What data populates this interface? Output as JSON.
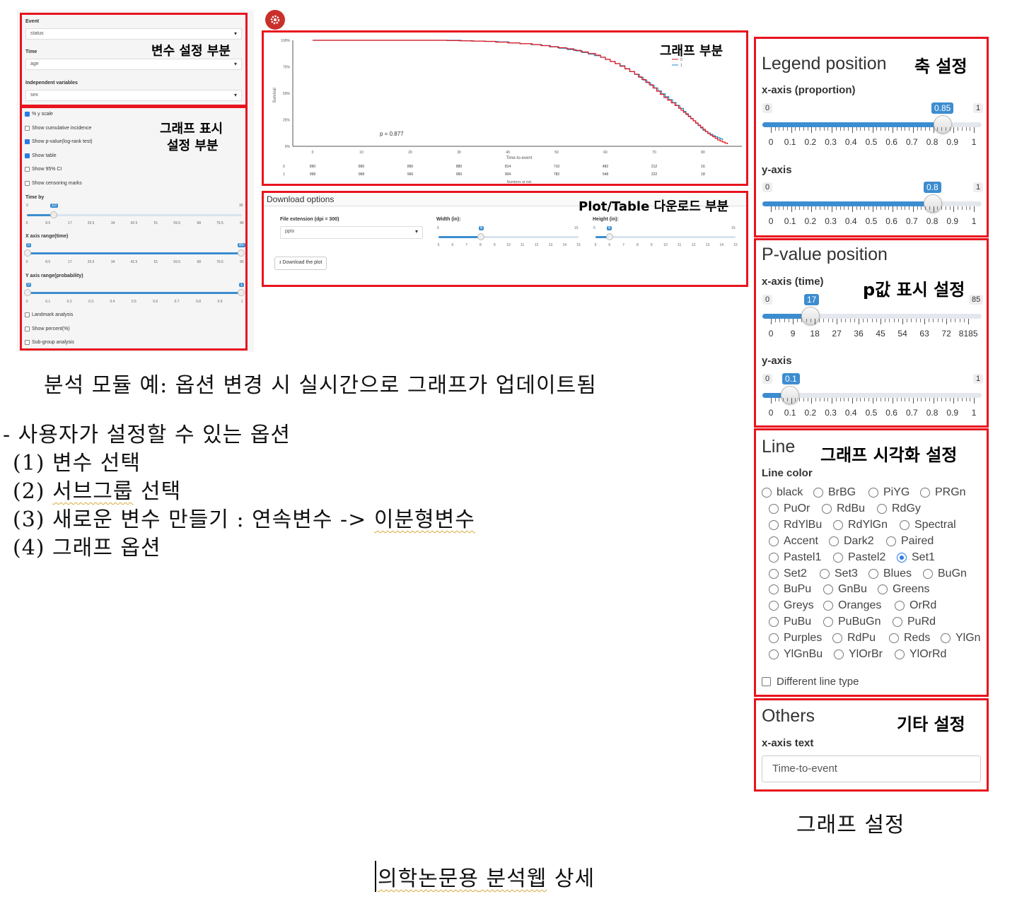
{
  "left_panel": {
    "event_label": "Event",
    "event_value": "status",
    "time_label": "Time",
    "time_value": "age",
    "indep_label": "Independent variables",
    "indep_value": "sex",
    "annot_variables": "변수 설정 부분",
    "annot_display_1": "그래프 표시",
    "annot_display_2": "설정 부분",
    "checks": [
      {
        "label": "% y scale",
        "checked": true
      },
      {
        "label": "Show cumulative incidence",
        "checked": false
      },
      {
        "label": "Show p-value(log-rank test)",
        "checked": true
      },
      {
        "label": "Show table",
        "checked": true
      },
      {
        "label": "Show 95% CI",
        "checked": false
      },
      {
        "label": "Show censoring marks",
        "checked": false
      }
    ],
    "timeby_label": "Time by",
    "timeby_min": "0",
    "timeby_max": "30",
    "timeby_value": "10",
    "timeby_ticks": [
      "0",
      "8.5",
      "17",
      "25.5",
      "34",
      "42.5",
      "51",
      "59.5",
      "68",
      "76.5",
      "85"
    ],
    "xrange_label": "X axis range(time)",
    "xrange_min": "0",
    "xrange_max": "85",
    "xrange_ticks": [
      "0",
      "8.5",
      "17",
      "25.5",
      "34",
      "42.5",
      "51",
      "59.5",
      "68",
      "76.5",
      "85"
    ],
    "yrange_label": "Y axis range(probability)",
    "yrange_min": "0",
    "yrange_max": "1",
    "yrange_ticks": [
      "0",
      "0.1",
      "0.2",
      "0.3",
      "0.4",
      "0.5",
      "0.6",
      "0.7",
      "0.8",
      "0.9",
      "1"
    ],
    "bottom_checks": [
      "Landmark analysis",
      "Show percent(%)",
      "Sub-group analysis"
    ]
  },
  "plot_panel": {
    "annot": "그래프 부분",
    "ylabel": "Survival",
    "yticks": [
      "100%",
      "75%",
      "50%",
      "25%",
      "0%"
    ],
    "xticks": [
      "0",
      "10",
      "20",
      "30",
      "40",
      "50",
      "60",
      "70",
      "80"
    ],
    "xlabel": "Time-to-event",
    "pvalue_text": "p = 0.877",
    "legend": [
      "0",
      "1"
    ],
    "risk_row0_label": "0",
    "risk_row0": [
      "890",
      "890",
      "890",
      "880",
      "814",
      "710",
      "482",
      "212",
      "16"
    ],
    "risk_row1_label": "1",
    "risk_row1": [
      "968",
      "968",
      "966",
      "960",
      "904",
      "782",
      "548",
      "222",
      "18"
    ],
    "risk_xlabel": "Numbers at risk"
  },
  "colors": {
    "series0": "#e8141e",
    "series1": "#1f8fc4",
    "accent": "#3c8dd0",
    "frame": "#e8141e"
  },
  "download_panel": {
    "title": "Download options",
    "annot": "Plot/Table 다운로드 부분",
    "ext_label": "File extension (dpi = 300)",
    "ext_value": "pptx",
    "width_label": "Width (in):",
    "width_value": "6",
    "width_min": "5",
    "width_max": "15",
    "height_label": "Height (in):",
    "height_value": "6",
    "height_min": "5",
    "height_max": "15",
    "size_ticks": [
      "5",
      "6",
      "7",
      "8",
      "9",
      "10",
      "11",
      "12",
      "13",
      "14",
      "15"
    ],
    "button": "Download the plot"
  },
  "captions": {
    "module": "분석 모듈 예: 옵션 변경 시 실시간으로 그래프가 업데이트됨",
    "options_title": "- 사용자가 설정할 수 있는 옵션",
    "opt1": "(1) 변수 선택",
    "opt2a": "(2) ",
    "opt2b": "서브그룹",
    "opt2c": " 선택",
    "opt3a": "(3) 새로운 변수 만들기 : 연속변수 -> ",
    "opt3b": "이분형변수",
    "opt4": "(4) 그래프 옵션",
    "graph_settings": "그래프 설정",
    "footer_a": "의학논문용",
    "footer_b": " 분석웹",
    "footer_c": " 상세"
  },
  "legend_section": {
    "title": "Legend position",
    "annot": "축 설정",
    "x_label": "x-axis (proportion)",
    "x_min": "0",
    "x_max": "1",
    "x_value": "0.85",
    "y_label": "y-axis",
    "y_min": "0",
    "y_max": "1",
    "y_value": "0.8",
    "ticks": [
      "0",
      "0.1",
      "0.2",
      "0.3",
      "0.4",
      "0.5",
      "0.6",
      "0.7",
      "0.8",
      "0.9",
      "1"
    ]
  },
  "pvalue_section": {
    "title": "P-value position",
    "annot": "p값 표시 설정",
    "x_label": "x-axis (time)",
    "x_min": "0",
    "x_max": "85",
    "x_value": "17",
    "x_ticks": [
      "0",
      "9",
      "18",
      "27",
      "36",
      "45",
      "54",
      "63",
      "72",
      "8185"
    ],
    "y_label": "y-axis",
    "y_min": "0",
    "y_max": "1",
    "y_value": "0.1",
    "y_ticks": [
      "0",
      "0.1",
      "0.2",
      "0.3",
      "0.4",
      "0.5",
      "0.6",
      "0.7",
      "0.8",
      "0.9",
      "1"
    ]
  },
  "line_section": {
    "title": "Line",
    "annot": "그래프 시각화 설정",
    "color_label": "Line color",
    "rows": [
      [
        "black",
        "BrBG",
        "PiYG",
        "PRGn"
      ],
      [
        "PuOr",
        "RdBu",
        "RdGy"
      ],
      [
        "RdYlBu",
        "RdYlGn",
        "Spectral"
      ],
      [
        "Accent",
        "Dark2",
        "Paired"
      ],
      [
        "Pastel1",
        "Pastel2",
        "Set1"
      ],
      [
        "Set2",
        "Set3",
        "Blues",
        "BuGn"
      ],
      [
        "BuPu",
        "GnBu",
        "Greens"
      ],
      [
        "Greys",
        "Oranges",
        "OrRd"
      ],
      [
        "PuBu",
        "PuBuGn",
        "PuRd"
      ],
      [
        "Purples",
        "RdPu",
        "Reds",
        "YlGn"
      ],
      [
        "YlGnBu",
        "YlOrBr",
        "YlOrRd"
      ]
    ],
    "selected": "Set1",
    "line_type_label": "Different line type"
  },
  "others_section": {
    "title": "Others",
    "annot": "기타 설정",
    "xtext_label": "x-axis text",
    "xtext_value": "Time-to-event"
  }
}
